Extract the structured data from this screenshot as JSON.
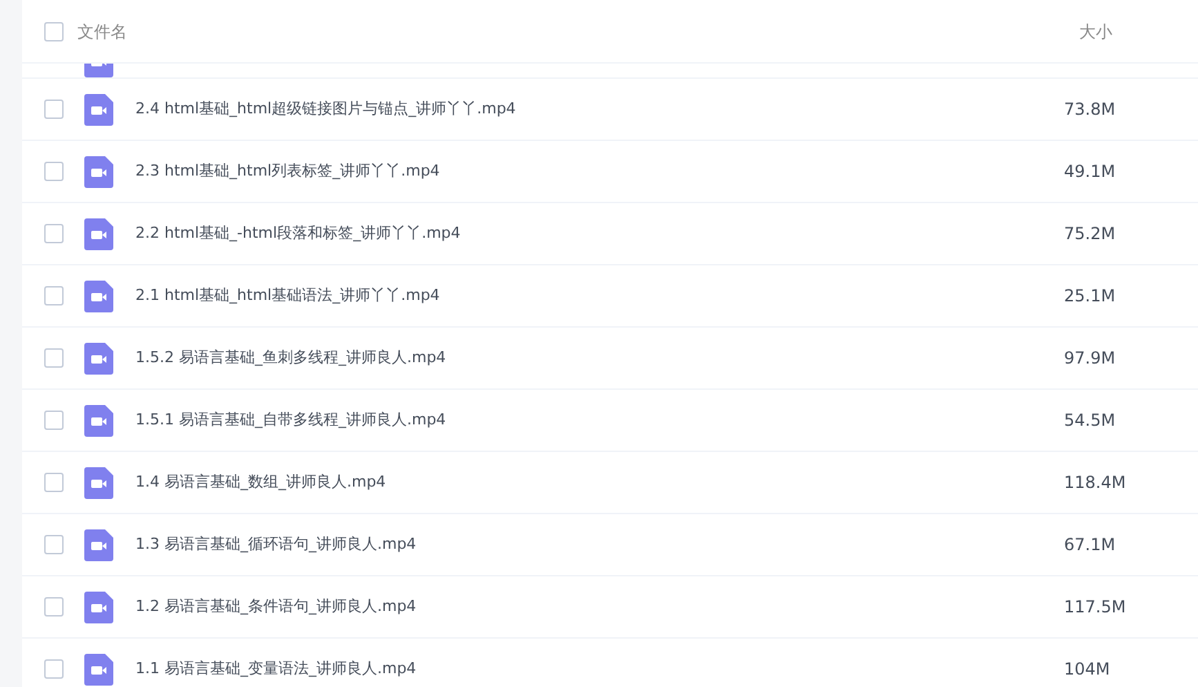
{
  "table": {
    "select_all": {
      "checked": false
    },
    "columns": [
      "文件名",
      "大小"
    ],
    "rows": [
      {
        "name": "2.4 html基础_html超级链接图片与锚点_讲师丫丫.mp4",
        "size": "73.8M",
        "checked": false
      },
      {
        "name": "2.3 html基础_html列表标签_讲师丫丫.mp4",
        "size": "49.1M",
        "checked": false
      },
      {
        "name": "2.2 html基础_-html段落和标签_讲师丫丫.mp4",
        "size": "75.2M",
        "checked": false
      },
      {
        "name": "2.1 html基础_html基础语法_讲师丫丫.mp4",
        "size": "25.1M",
        "checked": false
      },
      {
        "name": "1.5.2 易语言基础_鱼刺多线程_讲师良人.mp4",
        "size": "97.9M",
        "checked": false
      },
      {
        "name": "1.5.1 易语言基础_自带多线程_讲师良人.mp4",
        "size": "54.5M",
        "checked": false
      },
      {
        "name": "1.4 易语言基础_数组_讲师良人.mp4",
        "size": "118.4M",
        "checked": false
      },
      {
        "name": "1.3 易语言基础_循环语句_讲师良人.mp4",
        "size": "67.1M",
        "checked": false
      },
      {
        "name": "1.2 易语言基础_条件语句_讲师良人.mp4",
        "size": "117.5M",
        "checked": false
      },
      {
        "name": "1.1 易语言基础_变量语法_讲师良人.mp4",
        "size": "104M",
        "checked": false
      }
    ]
  }
}
